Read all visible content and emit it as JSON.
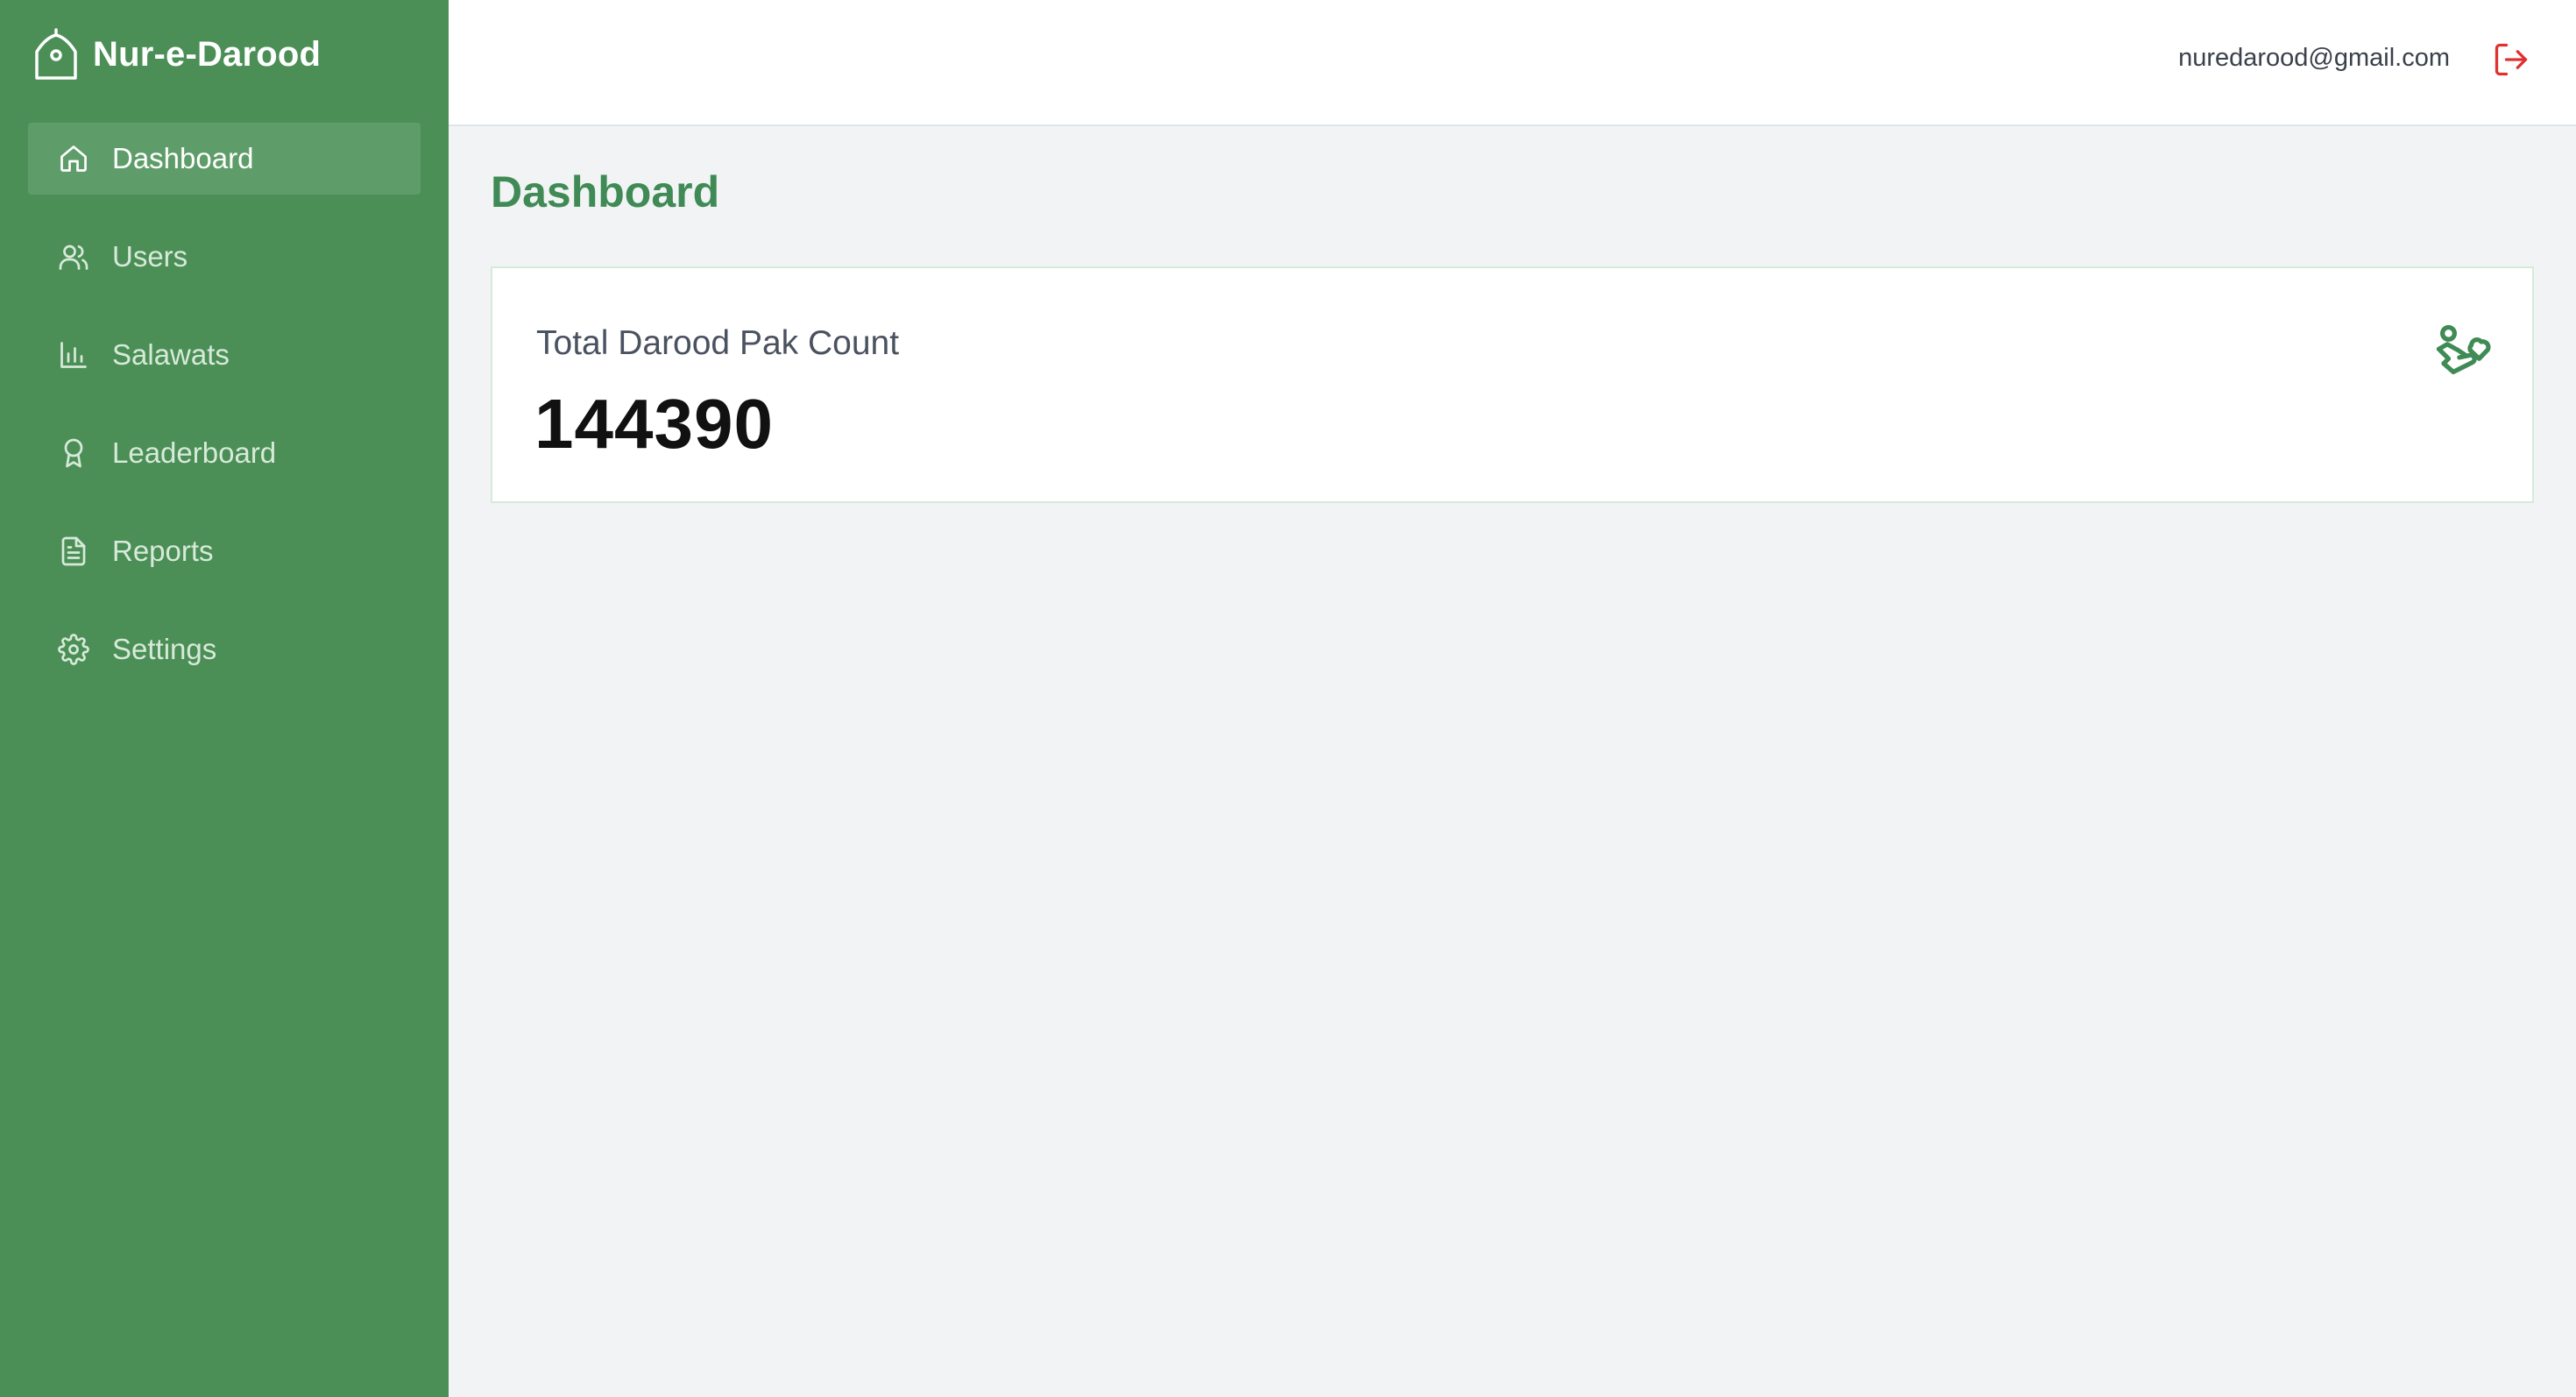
{
  "app": {
    "name": "Nur-e-Darood"
  },
  "sidebar": {
    "items": [
      {
        "label": "Dashboard",
        "icon": "home-icon",
        "active": true
      },
      {
        "label": "Users",
        "icon": "users-icon"
      },
      {
        "label": "Salawats",
        "icon": "bar-chart-icon"
      },
      {
        "label": "Leaderboard",
        "icon": "award-icon"
      },
      {
        "label": "Reports",
        "icon": "file-text-icon"
      },
      {
        "label": "Settings",
        "icon": "gear-icon"
      }
    ]
  },
  "header": {
    "user_email": "nuredarood@gmail.com",
    "logout_icon": "logout-icon"
  },
  "main": {
    "title": "Dashboard",
    "stat_card": {
      "label": "Total Darood Pak Count",
      "value": "144390",
      "icon": "hand-heart-icon"
    }
  },
  "colors": {
    "sidebar_bg": "#4b8f57",
    "accent": "#3f8a55",
    "logout": "#e03131"
  }
}
